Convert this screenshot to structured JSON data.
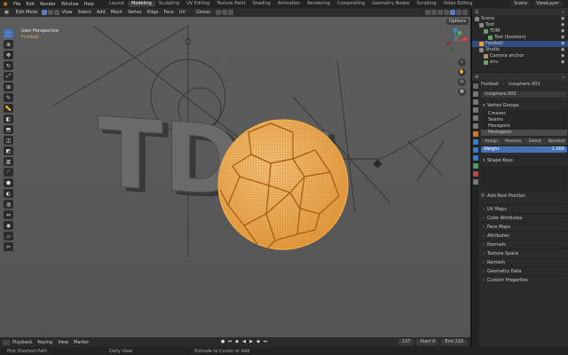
{
  "topbar": {
    "menus": [
      "File",
      "Edit",
      "Render",
      "Window",
      "Help"
    ],
    "workspaces": [
      "Layout",
      "Modeling",
      "Sculpting",
      "UV Editing",
      "Texture Paint",
      "Shading",
      "Animation",
      "Rendering",
      "Compositing",
      "Geometry Nodes",
      "Scripting",
      "Video Editing"
    ],
    "active_workspace": "Modeling",
    "scene": "Scene",
    "view_layer": "ViewLayer"
  },
  "viewport": {
    "mode": "Edit Mode",
    "menus": [
      "View",
      "Select",
      "Add",
      "Mesh",
      "Vertex",
      "Edge",
      "Face",
      "UV"
    ],
    "orientation": "Global",
    "perspective": "User Perspective",
    "options": "Options",
    "scene_text": "TDM",
    "accent_color": "#e8a040"
  },
  "outliner": {
    "rows": [
      {
        "label": "Scene",
        "depth": 0,
        "color": "#8a8a8a"
      },
      {
        "label": "Text",
        "depth": 1,
        "color": "#8a8a8a"
      },
      {
        "label": "TDM",
        "depth": 2,
        "color": "#6aa06a"
      },
      {
        "label": "Text (boolean)",
        "depth": 3,
        "color": "#6aa06a"
      },
      {
        "label": "Football",
        "depth": 1,
        "color": "#e8a040",
        "selected": true
      },
      {
        "label": "Studio",
        "depth": 1,
        "color": "#8a8a8a"
      },
      {
        "label": "Camera anchor",
        "depth": 2,
        "color": "#b09060"
      },
      {
        "label": "env",
        "depth": 2,
        "color": "#6aa06a"
      }
    ]
  },
  "properties": {
    "object": "Football",
    "breadcrumb_mesh": "Icosphere.003",
    "mesh_name": "Icosphere.003",
    "vertex_groups_label": "Vertex Groups",
    "vertex_groups": [
      "Creases",
      "Seams",
      "Hexagons",
      "Pentagons"
    ],
    "selected_group": "Pentagons",
    "buttons": [
      "Assign",
      "Remove",
      "Select",
      "Deselect"
    ],
    "weight_label": "Weight",
    "weight_value": "1.000",
    "shape_keys_label": "Shape Keys",
    "add_rest_position": "Add Rest Position",
    "sections": [
      "UV Maps",
      "Color Attributes",
      "Face Maps",
      "Attributes",
      "Normals",
      "Texture Space",
      "Remesh",
      "Geometry Data",
      "Custom Properties"
    ]
  },
  "timeline": {
    "menus": [
      "Playback",
      "Keying",
      "View",
      "Marker"
    ],
    "current_frame": "137",
    "start_label": "Start",
    "start": "0",
    "end_label": "End",
    "end": "210"
  },
  "statusbar": {
    "left": "Pick Shortest Path",
    "mid": "Dolly View",
    "right": "Extrude to Cursor or Add"
  }
}
